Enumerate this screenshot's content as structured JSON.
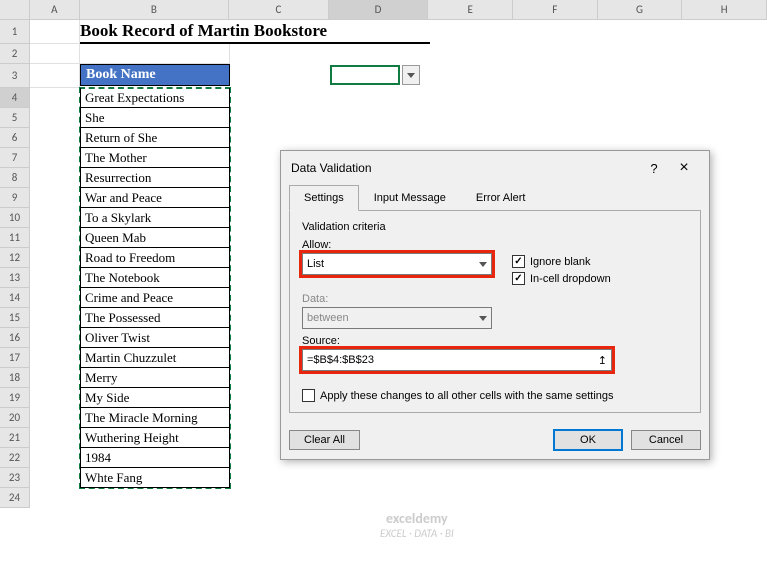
{
  "columns": [
    "A",
    "B",
    "C",
    "D",
    "E",
    "F",
    "G",
    "H"
  ],
  "rows": [
    "1",
    "2",
    "3",
    "4",
    "5",
    "6",
    "7",
    "8",
    "9",
    "10",
    "11",
    "12",
    "13",
    "14",
    "15",
    "16",
    "17",
    "18",
    "19",
    "20",
    "21",
    "22",
    "23",
    "24"
  ],
  "title": "Book Record of Martin Bookstore",
  "book_header": "Book Name",
  "books": [
    "Great Expectations",
    "She",
    "Return of She",
    "The Mother",
    "Resurrection",
    "War and Peace",
    "To a Skylark",
    "Queen Mab",
    "Road to Freedom",
    "The Notebook",
    "Crime and Peace",
    "The Possessed",
    "Oliver Twist",
    "Martin Chuzzulet",
    "Merry",
    "My Side",
    "The Miracle Morning",
    "Wuthering Height",
    "1984",
    "Whte Fang"
  ],
  "dialog": {
    "title": "Data Validation",
    "tabs": {
      "settings": "Settings",
      "input_message": "Input Message",
      "error_alert": "Error Alert"
    },
    "criteria_label": "Validation criteria",
    "allow_label": "Allow:",
    "allow_value": "List",
    "data_label": "Data:",
    "data_value": "between",
    "source_label": "Source:",
    "source_value": "=$B$4:$B$23",
    "ignore_blank": "Ignore blank",
    "incell_dropdown": "In-cell dropdown",
    "apply_all": "Apply these changes to all other cells with the same settings",
    "clear_all": "Clear All",
    "ok": "OK",
    "cancel": "Cancel"
  },
  "watermark": {
    "main": "exceldemy",
    "sub": "EXCEL · DATA · BI"
  }
}
